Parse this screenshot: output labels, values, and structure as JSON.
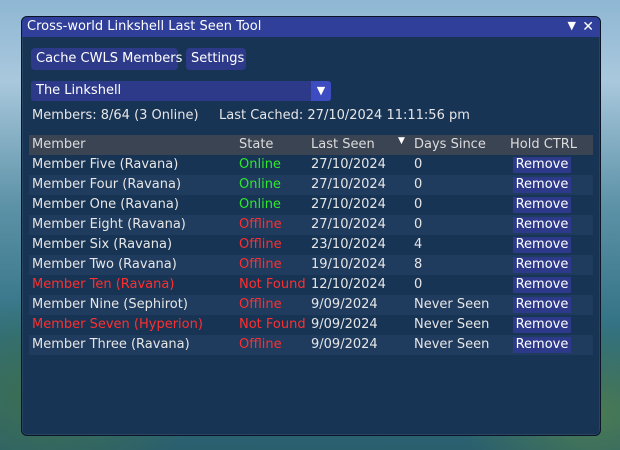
{
  "window": {
    "title": "Cross-world Linkshell Last Seen Tool",
    "collapse_icon": "▼",
    "close_icon": "✕"
  },
  "toolbar": {
    "cache_label": "Cache CWLS Members",
    "settings_label": "Settings"
  },
  "linkshell_select": {
    "value": "The Linkshell",
    "arrow": "▼"
  },
  "summary": {
    "members": "Members: 8/64 (3 Online)",
    "last_cached": "Last Cached: 27/10/2024 11:11:56 pm"
  },
  "table": {
    "columns": [
      "Member",
      "State",
      "Last Seen",
      "Days Since",
      "Hold CTRL"
    ],
    "sort_icon": "▼",
    "rows": [
      {
        "member": "Member Five (Ravana)",
        "state": "Online",
        "last_seen": "27/10/2024",
        "days": "0",
        "action": "Remove"
      },
      {
        "member": "Member Four (Ravana)",
        "state": "Online",
        "last_seen": "27/10/2024",
        "days": "0",
        "action": "Remove"
      },
      {
        "member": "Member One (Ravana)",
        "state": "Online",
        "last_seen": "27/10/2024",
        "days": "0",
        "action": "Remove"
      },
      {
        "member": "Member Eight (Ravana)",
        "state": "Offline",
        "last_seen": "27/10/2024",
        "days": "0",
        "action": "Remove"
      },
      {
        "member": "Member Six (Ravana)",
        "state": "Offline",
        "last_seen": "23/10/2024",
        "days": "4",
        "action": "Remove"
      },
      {
        "member": "Member Two (Ravana)",
        "state": "Offline",
        "last_seen": "19/10/2024",
        "days": "8",
        "action": "Remove"
      },
      {
        "member": "Member Ten (Ravana)",
        "state": "Not Found",
        "last_seen": "12/10/2024",
        "days": "0",
        "action": "Remove"
      },
      {
        "member": "Member Nine (Sephirot)",
        "state": "Offline",
        "last_seen": "9/09/2024",
        "days": "Never Seen",
        "action": "Remove"
      },
      {
        "member": "Member Seven (Hyperion)",
        "state": "Not Found",
        "last_seen": "9/09/2024",
        "days": "Never Seen",
        "action": "Remove"
      },
      {
        "member": "Member Three (Ravana)",
        "state": "Offline",
        "last_seen": "9/09/2024",
        "days": "Never Seen",
        "action": "Remove"
      }
    ]
  },
  "colors": {
    "online": "#2ee82e",
    "offline": "#ff2f2f",
    "not_found": "#ff2f2f",
    "accent": "#2d3a8a",
    "panel": "#173455"
  }
}
